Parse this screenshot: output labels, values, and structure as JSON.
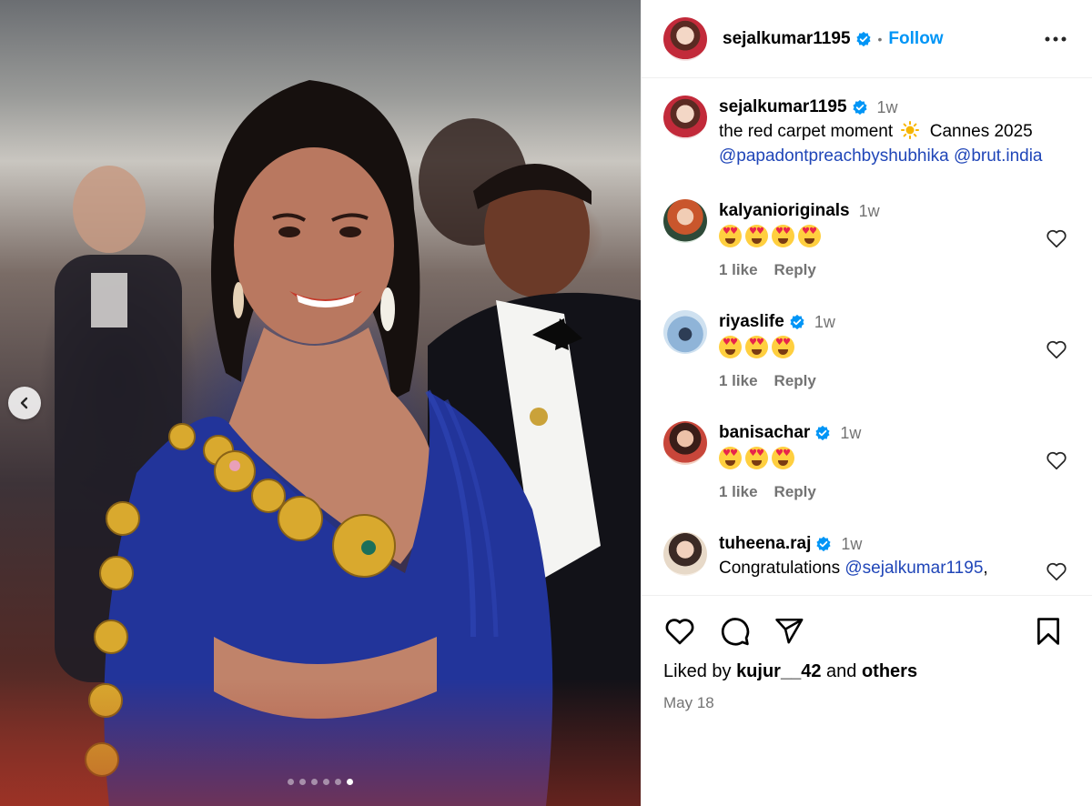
{
  "post": {
    "author": "sejalkumar1195",
    "follow_label": "Follow",
    "separator": "•",
    "date": "May 18",
    "slide_count": 6,
    "active_slide": 6
  },
  "caption": {
    "username": "sejalkumar1195",
    "time": "1w",
    "text": "the red carpet moment",
    "text_after": "Cannes 2025",
    "mention_1": "@papadontpreachbyshubhika",
    "mention_2": "@brut.india"
  },
  "comments": [
    {
      "username": "kalyanioriginals",
      "verified": false,
      "time": "1w",
      "emoji_count": 4,
      "likes": "1 like",
      "reply": "Reply"
    },
    {
      "username": "riyaslife",
      "verified": true,
      "time": "1w",
      "emoji_count": 3,
      "likes": "1 like",
      "reply": "Reply"
    },
    {
      "username": "banisachar",
      "verified": true,
      "time": "1w",
      "emoji_count": 3,
      "likes": "1 like",
      "reply": "Reply"
    },
    {
      "username": "tuheena.raj",
      "verified": true,
      "time": "1w",
      "text": "Congratulations",
      "mention": "@sejalkumar1195",
      "trail": ","
    }
  ],
  "likes": {
    "prefix": "Liked by",
    "user": "kujur__42",
    "middle": "and",
    "others": "others"
  },
  "icons": {
    "like": "heart-icon",
    "comment": "comment-icon",
    "share": "share-icon",
    "save": "bookmark-icon",
    "more": "more-horizontal-icon",
    "prev": "chevron-left-icon",
    "verified": "verified-badge-icon",
    "sun": "sun-emoji"
  },
  "colors": {
    "accent": "#0095f6",
    "mention": "#2046b8",
    "muted": "#737373",
    "divider": "#efefef"
  }
}
